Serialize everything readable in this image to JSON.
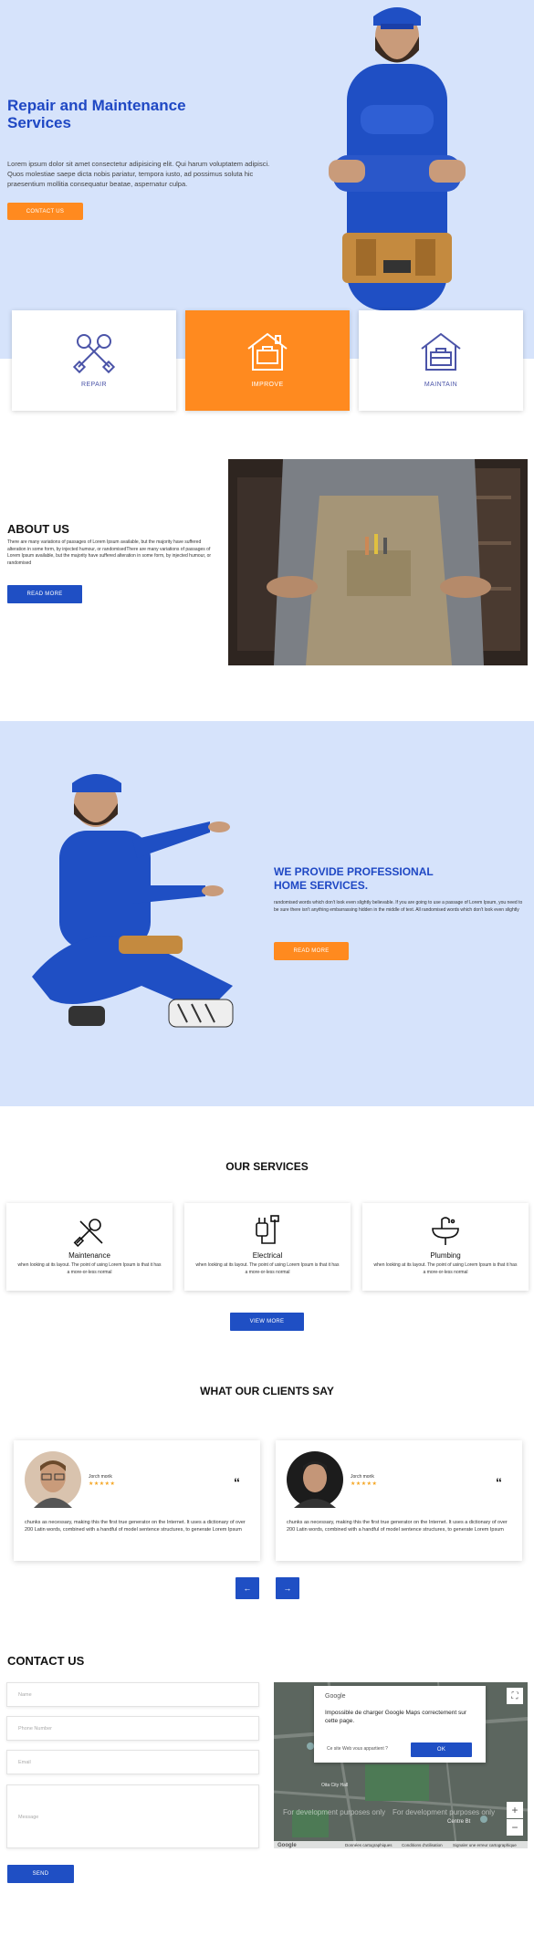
{
  "hero": {
    "title": "Repair and Maintenance Services",
    "text": "Lorem ipsum dolor sit amet consectetur adipisicing elit. Qui harum voluptatem adipisci. Quos molestiae saepe dicta nobis pariatur, tempora iusto, ad possimus soluta hic praesentium mollitia consequatur beatae, aspernatur culpa.",
    "button": "CONTACT US"
  },
  "features": [
    {
      "label": "REPAIR",
      "icon": "wrench-cross-icon"
    },
    {
      "label": "IMPROVE",
      "icon": "house-toolbox-icon"
    },
    {
      "label": "MAINTAIN",
      "icon": "house-toolbox-icon"
    }
  ],
  "about": {
    "title": "ABOUT US",
    "text": "There are many variations of passages of Lorem Ipsum available, but the majority have suffered alteration in some form, by injected humour, or randomisedThere are many variations of passages of Lorem Ipsum available, but the majority have suffered alteration in some form, by injected humour, or randomised",
    "button": "READ MORE"
  },
  "provide": {
    "title": "WE PROVIDE PROFESSIONAL HOME SERVICES.",
    "text": "randomised words which don't look even slightly believable. If you are going to use a passage of Lorem Ipsum, you need to be sure there isn't anything embarrassing hidden in the middle of text. All randomised words which don't look even slightly",
    "button": "READ MORE"
  },
  "services": {
    "title": "OUR SERVICES",
    "items": [
      {
        "title": "Maintenance",
        "text": "when looking at its layout. The point of using Lorem Ipsum is that it has a more-or-less normal"
      },
      {
        "title": "Electrical",
        "text": "when looking at its layout. The point of using Lorem Ipsum is that it has a more-or-less normal"
      },
      {
        "title": "Plumbing",
        "text": "when looking at its layout. The point of using Lorem Ipsum is that it has a more-or-less normal"
      }
    ],
    "button": "VIEW MORE"
  },
  "clients": {
    "title": "WHAT OUR CLIENTS SAY",
    "items": [
      {
        "name": "Jorch morik",
        "stars": "★★★★★",
        "quote": "“",
        "text": "chunks as necessary, making this the first true generator on the Internet. It uses a dictionary of over 200 Latin words, combined with a handful of model sentence structures, to generate Lorem Ipsum"
      },
      {
        "name": "Jorch morik",
        "stars": "★★★★★",
        "quote": "“",
        "text": "chunks as necessary, making this the first true generator on the Internet. It uses a dictionary of over 200 Latin words, combined with a handful of model sentence structures, to generate Lorem Ipsum"
      }
    ],
    "prev": "←",
    "next": "→"
  },
  "contact": {
    "title": "CONTACT US",
    "name_ph": "Name",
    "phone_ph": "Phone Number",
    "email_ph": "Email",
    "message_ph": "Message",
    "button": "SEND"
  },
  "map": {
    "brand": "Google",
    "dialog_title": "Impossible de charger Google Maps correctement sur cette page.",
    "dialog_question": "Ce site Web vous appartient ?",
    "ok": "OK",
    "dev1": "For development purposes only",
    "dev2": "For development purposes only",
    "place1": "Oita City Hall",
    "place2": "Centre Bt",
    "footer1": "Données cartographiques",
    "footer2": "Conditions d'utilisation",
    "footer3": "Signaler une erreur cartographique",
    "zoom_in": "+",
    "zoom_out": "−",
    "fullscreen": "⛶"
  }
}
